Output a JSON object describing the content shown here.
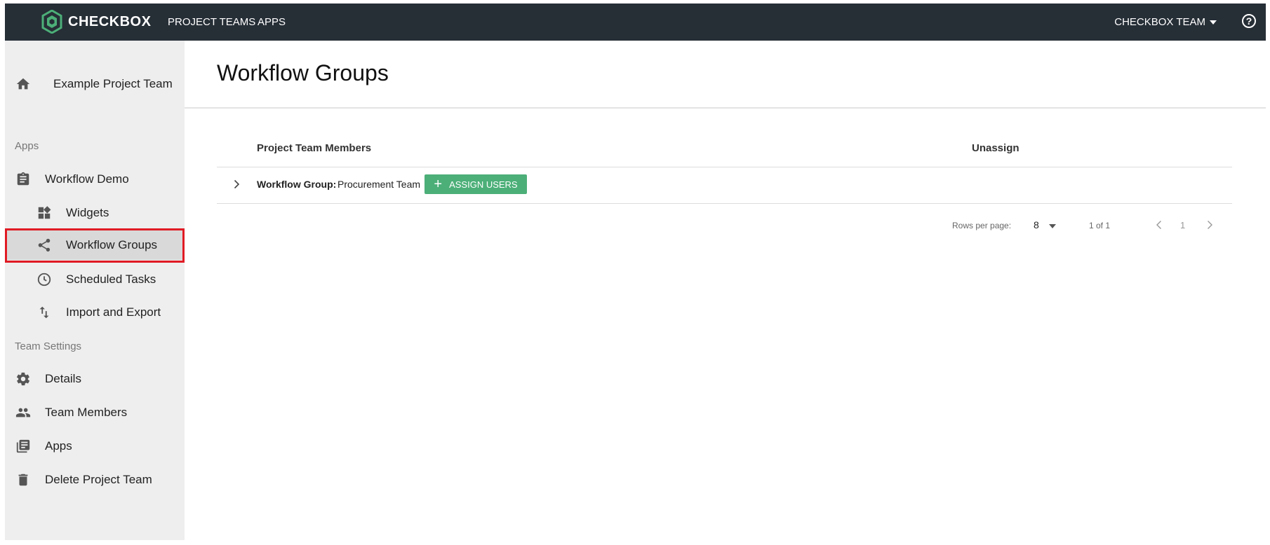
{
  "brand": {
    "name": "CHECKBOX",
    "accent": "#4caf78",
    "topbar_color": "#262e36",
    "highlight_color": "#e01b24"
  },
  "topnav": {
    "links": [
      {
        "label": "PROJECT TEAMS"
      },
      {
        "label": "APPS"
      }
    ],
    "team_menu": "CHECKBOX TEAM",
    "help_icon": "?"
  },
  "sidebar": {
    "team": {
      "label": "Example Project Team",
      "icon": "home-icon"
    },
    "sections": [
      {
        "title": "Apps"
      },
      {
        "title": "Team Settings"
      }
    ],
    "items": [
      {
        "label": "Workflow Demo",
        "icon": "clipboard-icon"
      },
      {
        "label": "Widgets",
        "icon": "widgets-icon"
      },
      {
        "label": "Workflow Groups",
        "icon": "share-icon",
        "active": true
      },
      {
        "label": "Scheduled Tasks",
        "icon": "clock-icon"
      },
      {
        "label": "Import and Export",
        "icon": "import-export-icon"
      },
      {
        "label": "Details",
        "icon": "gear-icon"
      },
      {
        "label": "Team Members",
        "icon": "people-icon"
      },
      {
        "label": "Apps",
        "icon": "library-icon"
      },
      {
        "label": "Delete Project Team",
        "icon": "trash-icon"
      }
    ]
  },
  "main": {
    "title": "Workflow Groups",
    "table": {
      "columns": [
        "Project Team Members",
        "Unassign"
      ],
      "rows": [
        {
          "key": "Workflow Group:",
          "value": "Procurement Team",
          "button": "ASSIGN USERS"
        }
      ]
    },
    "pagination": {
      "rows_per_page_label": "Rows per page:",
      "rows_per_page": "8",
      "range": "1 of 1",
      "page": "1"
    }
  }
}
